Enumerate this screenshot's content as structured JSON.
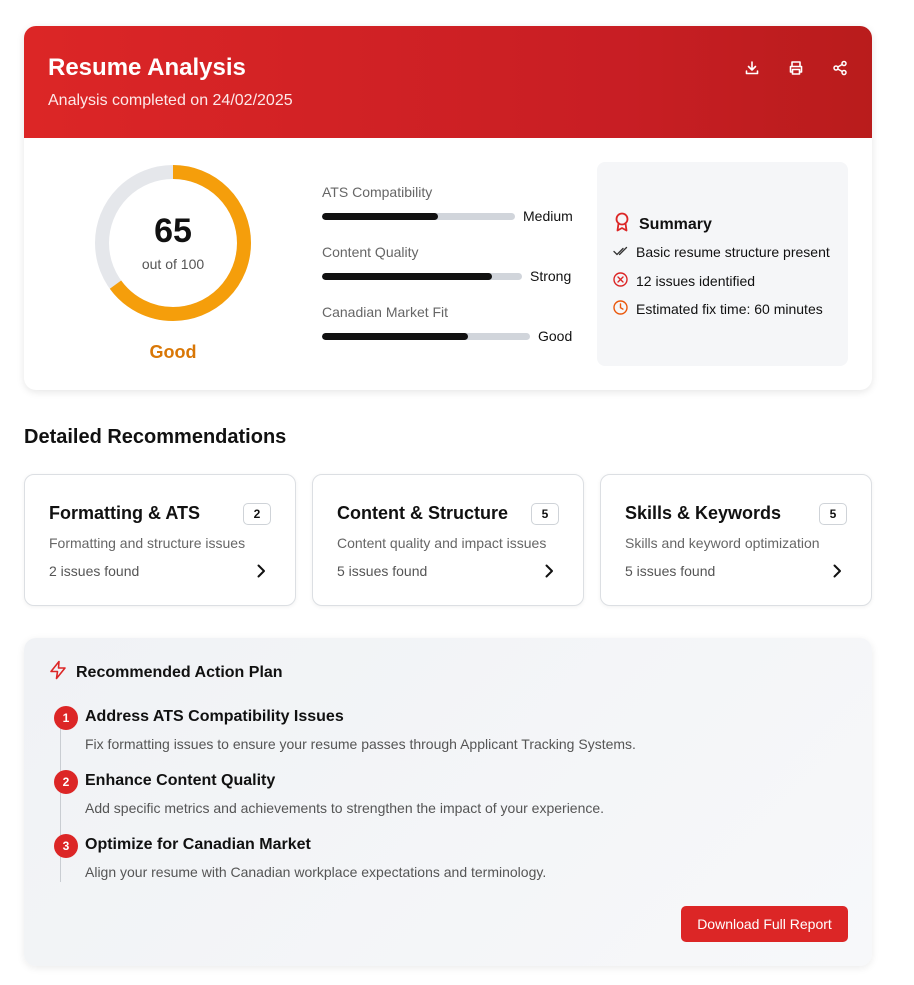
{
  "header": {
    "title": "Resume Analysis",
    "subtitle": "Analysis completed on 24/02/2025",
    "icons": [
      "download-icon",
      "print-icon",
      "share-icon"
    ]
  },
  "score": {
    "value": "65",
    "out_of": "out of 100",
    "rating": "Good",
    "fraction": 0.65,
    "ring_color": "#f59e0b",
    "rating_color": "#d97706"
  },
  "metrics": [
    {
      "label": "ATS Compatibility",
      "value": "Medium",
      "fill": 0.6
    },
    {
      "label": "Content Quality",
      "value": "Strong",
      "fill": 0.85
    },
    {
      "label": "Canadian Market Fit",
      "value": "Good",
      "fill": 0.7
    }
  ],
  "summary": {
    "title": "Summary",
    "items": [
      {
        "icon": "double-check-icon",
        "text": "Basic resume structure present"
      },
      {
        "icon": "x-circle-icon",
        "text": "12 issues identified"
      },
      {
        "icon": "clock-icon",
        "text": "Estimated fix time: 60 minutes"
      }
    ]
  },
  "recommendations": {
    "title": "Detailed Recommendations",
    "cards": [
      {
        "title": "Formatting & ATS",
        "badge": "2",
        "desc": "Formatting and structure issues",
        "count": "2 issues found"
      },
      {
        "title": "Content & Structure",
        "badge": "5",
        "desc": "Content quality and impact issues",
        "count": "5 issues found"
      },
      {
        "title": "Skills & Keywords",
        "badge": "5",
        "desc": "Skills and keyword optimization",
        "count": "5 issues found"
      }
    ]
  },
  "plan": {
    "title": "Recommended Action Plan",
    "steps": [
      {
        "num": "1",
        "title": "Address ATS Compatibility Issues",
        "desc": "Fix formatting issues to ensure your resume passes through Applicant Tracking Systems."
      },
      {
        "num": "2",
        "title": "Enhance Content Quality",
        "desc": "Add specific metrics and achievements to strengthen the impact of your experience."
      },
      {
        "num": "3",
        "title": "Optimize for Canadian Market",
        "desc": "Align your resume with Canadian workplace expectations and terminology."
      }
    ],
    "button": "Download Full Report"
  },
  "colors": {
    "brand_red": "#dc2626",
    "accent_orange": "#f59e0b"
  }
}
